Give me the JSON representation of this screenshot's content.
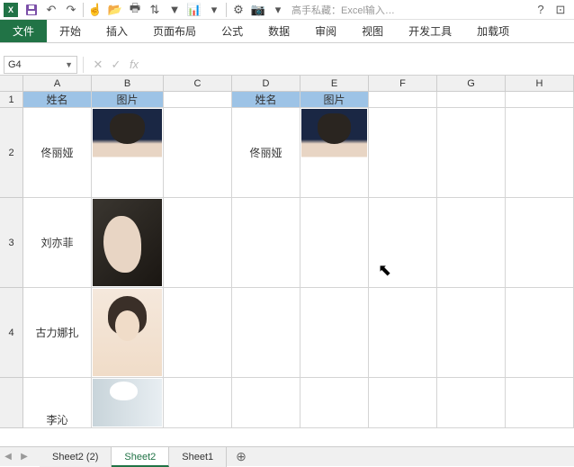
{
  "app": {
    "excel_letter": "X"
  },
  "qat": {
    "hint_text": "高手私藏：Excel输入…"
  },
  "ribbon": {
    "tabs": {
      "file": "文件",
      "home": "开始",
      "insert": "插入",
      "page_layout": "页面布局",
      "formulas": "公式",
      "data": "数据",
      "review": "审阅",
      "view": "视图",
      "developer": "开发工具",
      "addins": "加载项"
    }
  },
  "fbar": {
    "name_box": "G4",
    "formula": ""
  },
  "grid": {
    "cols": [
      "A",
      "B",
      "C",
      "D",
      "E",
      "F",
      "G",
      "H"
    ],
    "rows": [
      "1",
      "2",
      "3",
      "4"
    ],
    "headers": {
      "name": "姓名",
      "image": "图片"
    },
    "names": {
      "r2": "佟丽娅",
      "r3": "刘亦菲",
      "r4": "古力娜扎",
      "r5": "李沁"
    },
    "names_d": {
      "r2": "佟丽娅"
    }
  },
  "sheets": {
    "tab1": "Sheet2 (2)",
    "tab2": "Sheet2",
    "tab3": "Sheet1"
  },
  "col_widths": {
    "A": 76,
    "B": 80,
    "C": 76,
    "D": 76,
    "E": 76,
    "F": 76,
    "G": 76,
    "H": 76
  },
  "row_heights": {
    "r1": 18,
    "r2": 100,
    "r3": 100,
    "r4": 100,
    "r5": 56
  }
}
